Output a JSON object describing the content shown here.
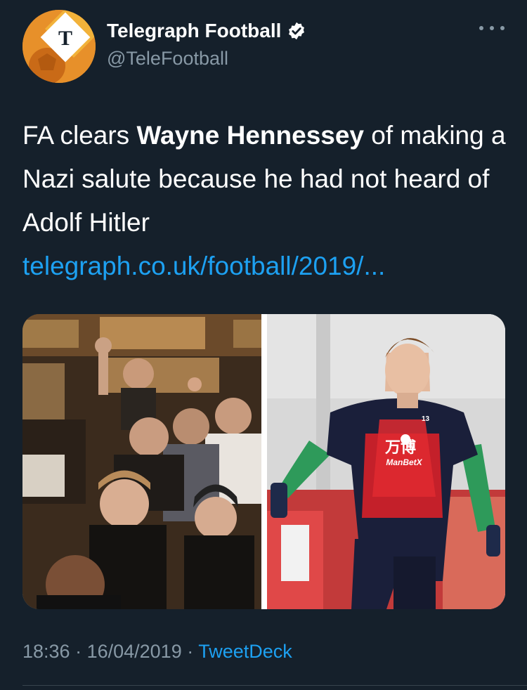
{
  "tweet": {
    "display_name": "Telegraph Football",
    "handle": "@TeleFootball",
    "text_part1": "FA clears ",
    "text_bold": "Wayne Hennessey",
    "text_part2": " of making a Nazi salute because he had not heard of Adolf Hitler",
    "link": "telegraph.co.uk/football/2019/...",
    "time": "18:36",
    "separator": " · ",
    "date": "16/04/2019",
    "source": "TweetDeck",
    "shirt_sponsor": "万博",
    "shirt_sponsor_sub": "ManBetX",
    "shirt_number": "13"
  },
  "icons": {
    "avatar": "telegraph-logo-icon",
    "verified": "verified-badge-icon",
    "more": "more-options-icon"
  },
  "colors": {
    "background": "#15202b",
    "primary_text": "#ffffff",
    "secondary_text": "#8899a6",
    "link": "#1da1f2",
    "avatar_orange": "#e7902a"
  }
}
